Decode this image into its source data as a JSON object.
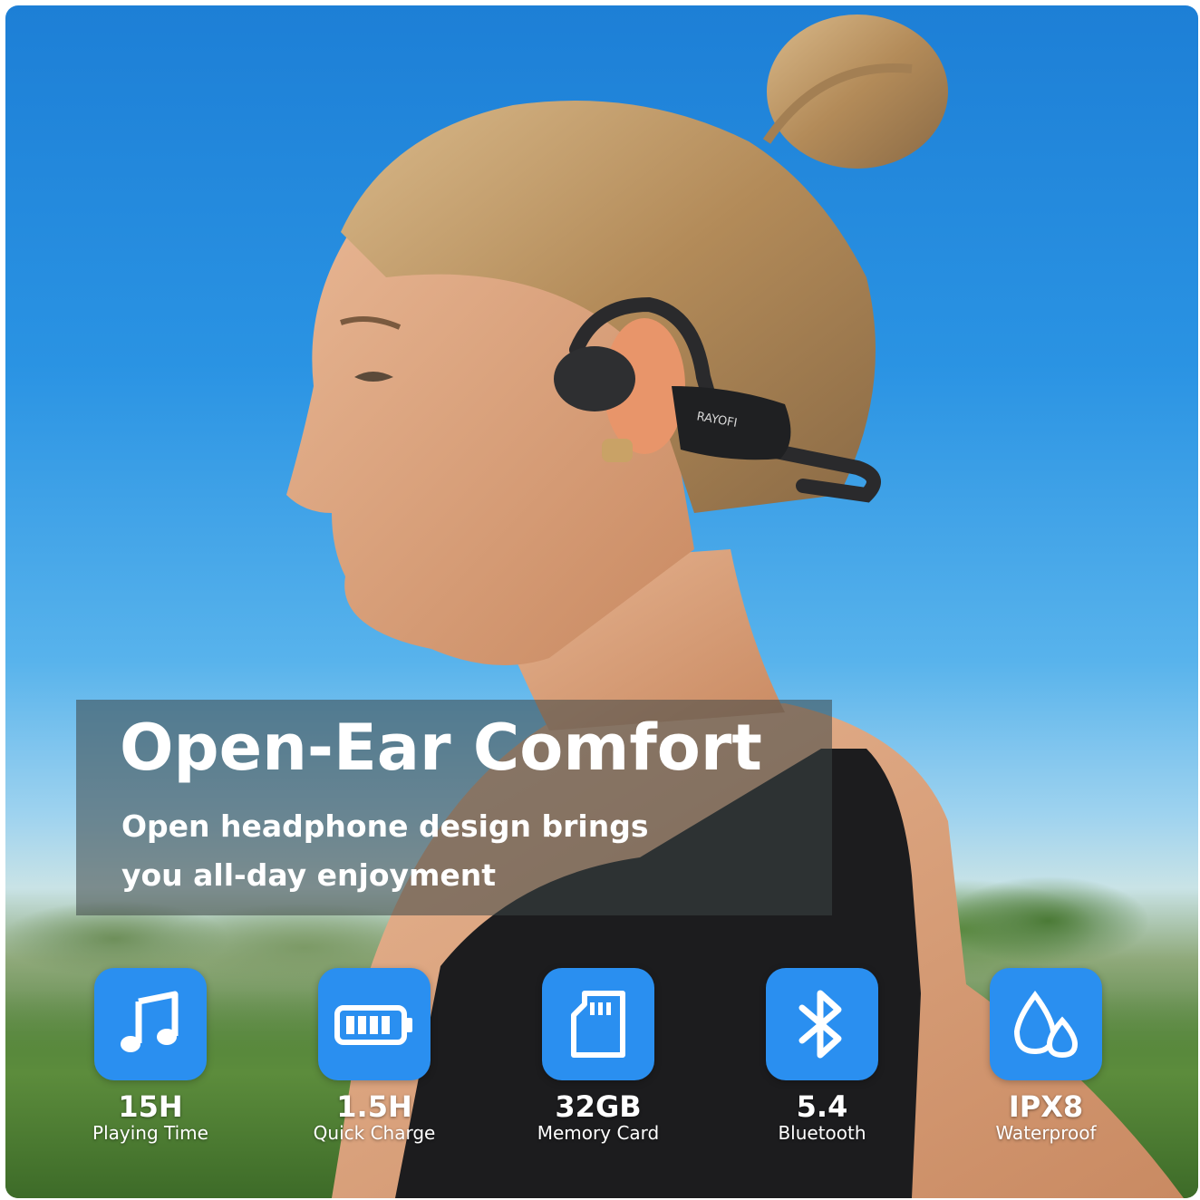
{
  "banner": {
    "headline": "Open-Ear Comfort",
    "subline_1": "Open headphone design brings",
    "subline_2": "you all-day enjoyment"
  },
  "product": {
    "brand_mark": "RAYOFI"
  },
  "features": [
    {
      "icon": "music-note-icon",
      "value": "15H",
      "label": "Playing Time"
    },
    {
      "icon": "battery-icon",
      "value": "1.5H",
      "label": "Quick Charge"
    },
    {
      "icon": "memory-card-icon",
      "value": "32GB",
      "label": "Memory Card"
    },
    {
      "icon": "bluetooth-icon",
      "value": "5.4",
      "label": "Bluetooth"
    },
    {
      "icon": "water-drops-icon",
      "value": "IPX8",
      "label": "Waterproof"
    }
  ],
  "colors": {
    "tile": "#2a8ff0",
    "sky": "#2a93e3",
    "overlay": "#3c4646"
  }
}
